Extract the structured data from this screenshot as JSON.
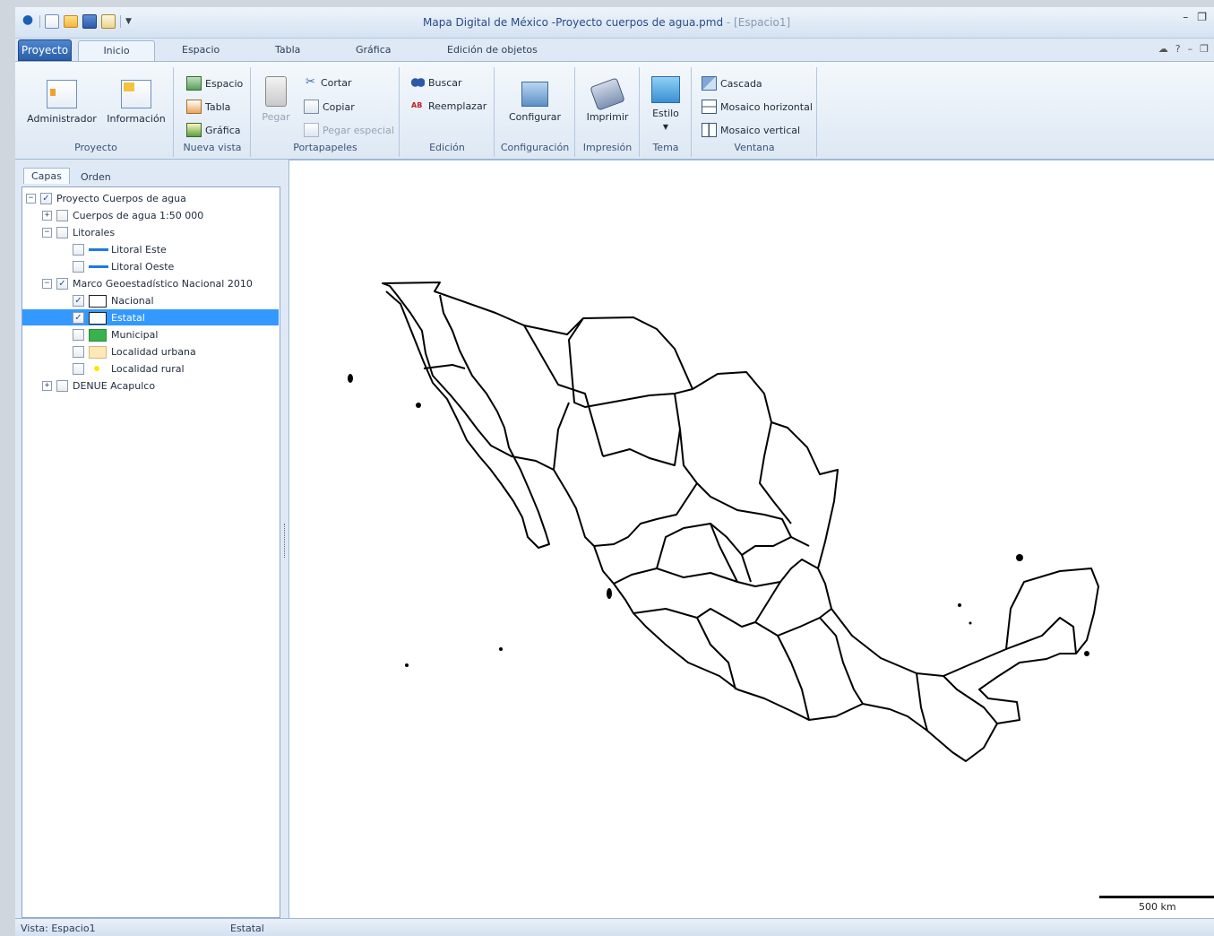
{
  "window": {
    "title": "Mapa Digital de México -Proyecto cuerpos de agua.pmd",
    "subtitle": " - [Espacio1]",
    "controls": [
      "–",
      "❐"
    ]
  },
  "ribbon_tabs": {
    "app_button": "Proyecto",
    "tabs": [
      "Inicio",
      "Espacio",
      "Tabla",
      "Gráfica",
      "Edición de objetos"
    ],
    "right_controls": [
      "☁",
      "?",
      "–",
      "❐"
    ]
  },
  "ribbon": {
    "proyecto": {
      "label": "Proyecto",
      "administrador": "Administrador",
      "informacion": "Información"
    },
    "nueva_vista": {
      "label": "Nueva vista",
      "espacio": "Espacio",
      "tabla": "Tabla",
      "grafica": "Gráfica"
    },
    "portapapeles": {
      "label": "Portapapeles",
      "pegar": "Pegar",
      "cortar": "Cortar",
      "copiar": "Copiar",
      "pegar_especial": "Pegar especial"
    },
    "edicion": {
      "label": "Edición",
      "buscar": "Buscar",
      "reemplazar": "Reemplazar"
    },
    "configuracion": {
      "label": "Configuración",
      "configurar": "Configurar"
    },
    "impresion": {
      "label": "Impresión",
      "imprimir": "Imprimir"
    },
    "tema": {
      "label": "Tema",
      "estilo": "Estilo"
    },
    "ventana": {
      "label": "Ventana",
      "cascada": "Cascada",
      "mosaico_horizontal": "Mosaico horizontal",
      "mosaico_vertical": "Mosaico vertical"
    }
  },
  "panel": {
    "tabs": [
      "Capas",
      "Orden"
    ],
    "tree": [
      {
        "label": "Proyecto Cuerpos de agua",
        "checked": true,
        "expander": "−"
      },
      {
        "label": "Cuerpos de agua 1:50 000",
        "checked": false,
        "expander": "+"
      },
      {
        "label": "Litorales",
        "checked": false,
        "expander": "−"
      },
      {
        "label": "Litoral Este",
        "checked": false
      },
      {
        "label": "Litoral Oeste",
        "checked": false
      },
      {
        "label": "Marco Geoestadístico Nacional 2010",
        "checked": true,
        "expander": "−"
      },
      {
        "label": "Nacional",
        "checked": true
      },
      {
        "label": "Estatal",
        "checked": true,
        "selected": true
      },
      {
        "label": "Municipal",
        "checked": false
      },
      {
        "label": "Localidad urbana",
        "checked": false
      },
      {
        "label": "Localidad rural",
        "checked": false
      },
      {
        "label": "DENUE Acapulco",
        "checked": false,
        "expander": "+"
      }
    ]
  },
  "map": {
    "scale_label": "500 km"
  },
  "status": {
    "vista": "Vista: Espacio1",
    "capa": "Estatal"
  },
  "colors": {
    "accent": "#2a5ea8",
    "selection": "#3399ff",
    "litoral": "#1f7ae0",
    "municipal": "#37b24d"
  }
}
